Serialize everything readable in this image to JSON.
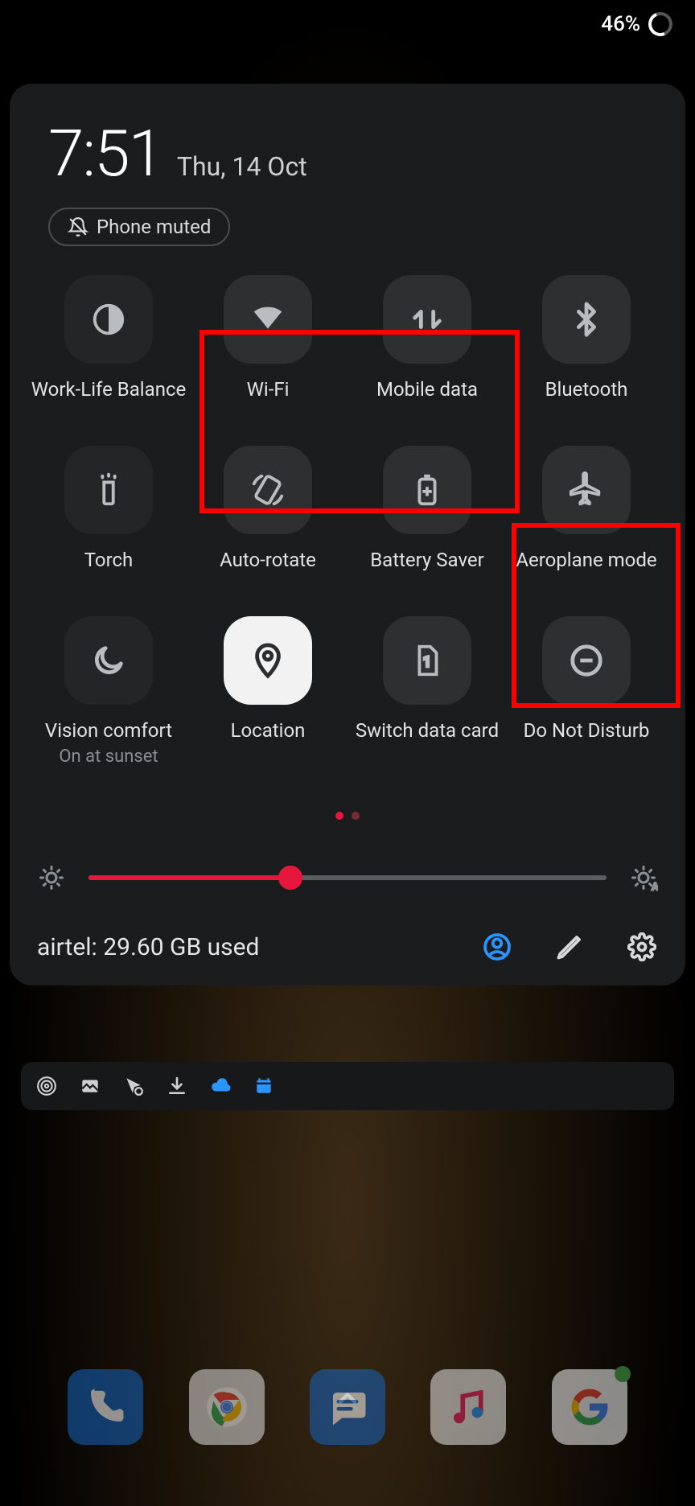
{
  "status": {
    "battery_pct": "46%"
  },
  "clock": {
    "time": "7:51",
    "date": "Thu, 14 Oct"
  },
  "muted_chip": "Phone muted",
  "tiles": [
    {
      "label": "Work-Life Balance",
      "icon": "work-life-balance-icon",
      "on": false
    },
    {
      "label": "Wi-Fi",
      "icon": "wifi-icon",
      "on": false
    },
    {
      "label": "Mobile data",
      "icon": "mobile-data-icon",
      "on": false
    },
    {
      "label": "Bluetooth",
      "icon": "bluetooth-icon",
      "on": false
    },
    {
      "label": "Torch",
      "icon": "torch-icon",
      "on": false
    },
    {
      "label": "Auto-rotate",
      "icon": "auto-rotate-icon",
      "on": false
    },
    {
      "label": "Battery Saver",
      "icon": "battery-saver-icon",
      "on": false
    },
    {
      "label": "Aeroplane mode",
      "icon": "aeroplane-icon",
      "on": false
    },
    {
      "label": "Vision comfort",
      "icon": "vision-comfort-icon",
      "on": false,
      "sub": "On at sunset"
    },
    {
      "label": "Location",
      "icon": "location-icon",
      "on": true
    },
    {
      "label": "Switch data card",
      "icon": "sim-card-icon",
      "on": false
    },
    {
      "label": "Do Not Disturb",
      "icon": "dnd-icon",
      "on": false
    }
  ],
  "page_dots": {
    "count": 2,
    "active": 0
  },
  "brightness": {
    "pct": 39
  },
  "carrier_line": "airtel: 29.60 GB used",
  "notif_icons": [
    "hotspot-icon",
    "gallery-icon",
    "pointer-icon",
    "download-icon",
    "cloud-icon",
    "calendar-icon"
  ],
  "dock": [
    "phone",
    "chrome",
    "messages",
    "music",
    "google"
  ]
}
